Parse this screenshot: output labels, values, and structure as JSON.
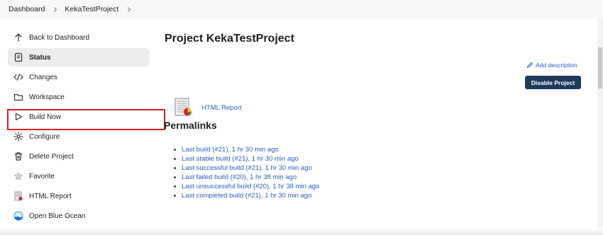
{
  "breadcrumb": {
    "items": [
      "Dashboard",
      "KekaTestProject"
    ]
  },
  "sidebar": {
    "items": [
      {
        "label": "Back to Dashboard",
        "icon": "arrow-up-icon"
      },
      {
        "label": "Status",
        "icon": "document-icon",
        "active": true
      },
      {
        "label": "Changes",
        "icon": "code-icon"
      },
      {
        "label": "Workspace",
        "icon": "folder-icon"
      },
      {
        "label": "Build Now",
        "icon": "play-icon"
      },
      {
        "label": "Configure",
        "icon": "gear-icon"
      },
      {
        "label": "Delete Project",
        "icon": "trash-icon"
      },
      {
        "label": "Favorite",
        "icon": "star-icon"
      },
      {
        "label": "HTML Report",
        "icon": "html-report-icon"
      },
      {
        "label": "Open Blue Ocean",
        "icon": "blue-ocean-icon"
      }
    ]
  },
  "main": {
    "title": "Project KekaTestProject",
    "add_description": "Add description",
    "disable_button": "Disable Project",
    "html_report_link": "HTML Report",
    "permalinks_title": "Permalinks",
    "permalinks": [
      "Last build (#21), 1 hr 30 min ago",
      "Last stable build (#21), 1 hr 30 min ago",
      "Last successful build (#21), 1 hr 30 min ago",
      "Last failed build (#20), 1 hr 38 min ago",
      "Last unsuccessful build (#20), 1 hr 38 min ago",
      "Last completed build (#21), 1 hr 30 min ago"
    ]
  },
  "colors": {
    "link": "#2a5bc4",
    "button_bg": "#1e3a5c",
    "highlight": "#e11d1d",
    "active_bg": "#ececee"
  }
}
